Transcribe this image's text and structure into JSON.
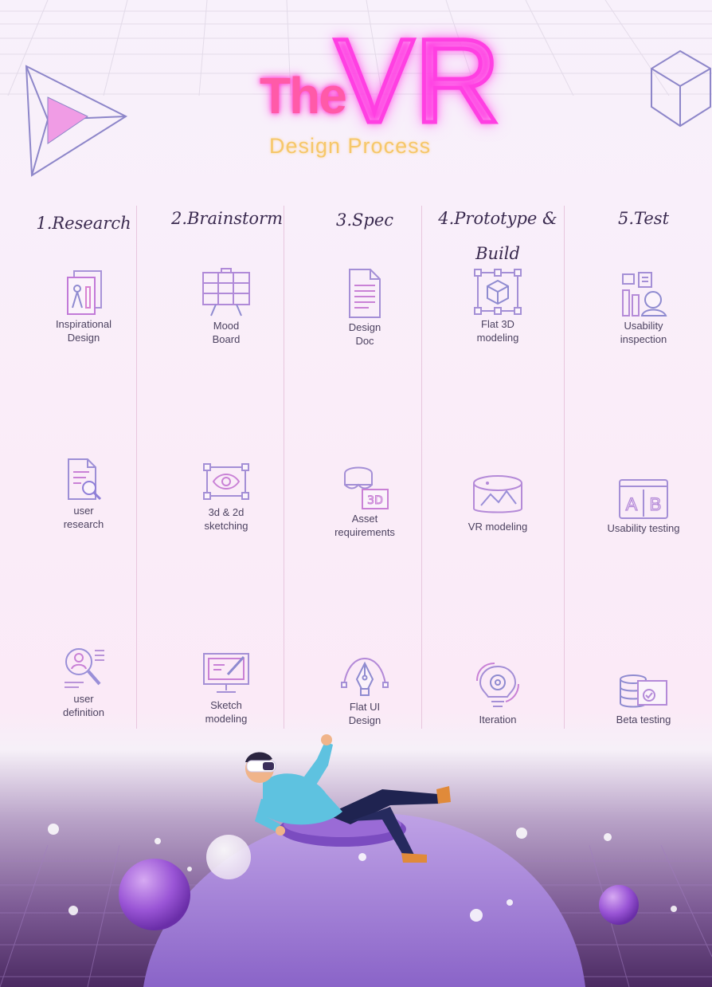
{
  "title": {
    "the": "The",
    "vr": "VR",
    "subtitle": "Design Process"
  },
  "colors": {
    "neon_pink": "#ff3fe2",
    "gold": "#f6c76a",
    "purple": "#8f5bd1",
    "ink": "#3a2a4f"
  },
  "phases": [
    {
      "heading": "1.Research",
      "steps": [
        {
          "label": "Inspirational\nDesign",
          "icon": "drawing-tools-icon"
        },
        {
          "label": "user\nresearch",
          "icon": "document-search-icon"
        },
        {
          "label": "user\ndefinition",
          "icon": "user-search-icon"
        }
      ]
    },
    {
      "heading": "2.Brainstorm",
      "steps": [
        {
          "label": "Mood\nBoard",
          "icon": "mood-board-icon"
        },
        {
          "label": "3d & 2d\nsketching",
          "icon": "eye-sketch-icon"
        },
        {
          "label": "Sketch\nmodeling",
          "icon": "monitor-pen-icon"
        }
      ]
    },
    {
      "heading": "3.Spec",
      "steps": [
        {
          "label": "Design\nDoc",
          "icon": "document-icon"
        },
        {
          "label": "Asset\nrequirements",
          "icon": "vr-headset-3d-icon"
        },
        {
          "label": "Flat UI\nDesign",
          "icon": "pen-tool-icon"
        }
      ]
    },
    {
      "heading": "4.Prototype &\nBuild",
      "steps": [
        {
          "label": "Flat 3D\nmodeling",
          "icon": "cube-frame-icon"
        },
        {
          "label": "VR modeling",
          "icon": "panorama-icon"
        },
        {
          "label": "Iteration",
          "icon": "lightbulb-gear-icon"
        }
      ]
    },
    {
      "heading": "5.Test",
      "steps": [
        {
          "label": "Usability\ninspection",
          "icon": "inspection-icon"
        },
        {
          "label": "Usability testing",
          "icon": "ab-test-icon"
        },
        {
          "label": "Beta testing",
          "icon": "database-check-icon"
        }
      ]
    }
  ]
}
